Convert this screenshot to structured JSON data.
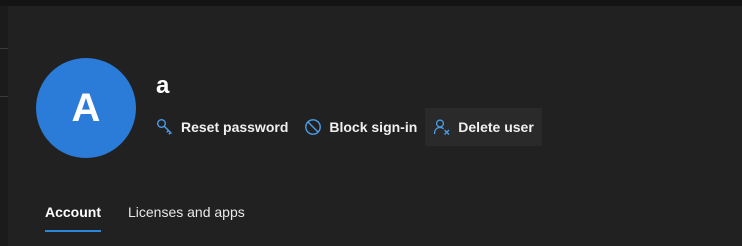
{
  "user": {
    "avatar_initial": "A",
    "name": "a"
  },
  "actions": [
    {
      "label": "Reset password",
      "icon": "key-icon"
    },
    {
      "label": "Block sign-in",
      "icon": "block-icon"
    },
    {
      "label": "Delete user",
      "icon": "delete-user-icon"
    }
  ],
  "tabs": [
    {
      "label": "Account",
      "active": true
    },
    {
      "label": "Licenses and apps",
      "active": false
    }
  ],
  "colors": {
    "background": "#212121",
    "avatar": "#2b7bd8",
    "accent": "#2b88d8",
    "icon": "#4a9eea"
  }
}
